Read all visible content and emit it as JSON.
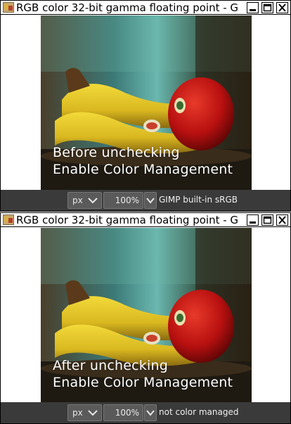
{
  "colors": {
    "statusbar_bg": "#3a3a3a",
    "field_bg": "#5a5a5a",
    "overlay_text": "#ffffff"
  },
  "windows": [
    {
      "title": "RGB color 32-bit gamma floating point - G",
      "overlay_line1": "Before unchecking",
      "overlay_line2": "Enable Color Management",
      "unit": "px",
      "zoom": "100%",
      "color_profile": "GIMP built-in sRGB",
      "icons": [
        "gimp-app-icon",
        "minimize-icon",
        "maximize-icon",
        "close-icon",
        "chevron-down-icon"
      ]
    },
    {
      "title": "RGB color 32-bit gamma floating point - G",
      "overlay_line1": "After unchecking",
      "overlay_line2": "Enable Color Management",
      "unit": "px",
      "zoom": "100%",
      "color_profile": "not color managed",
      "icons": [
        "gimp-app-icon",
        "minimize-icon",
        "maximize-icon",
        "close-icon",
        "chevron-down-icon"
      ]
    }
  ]
}
